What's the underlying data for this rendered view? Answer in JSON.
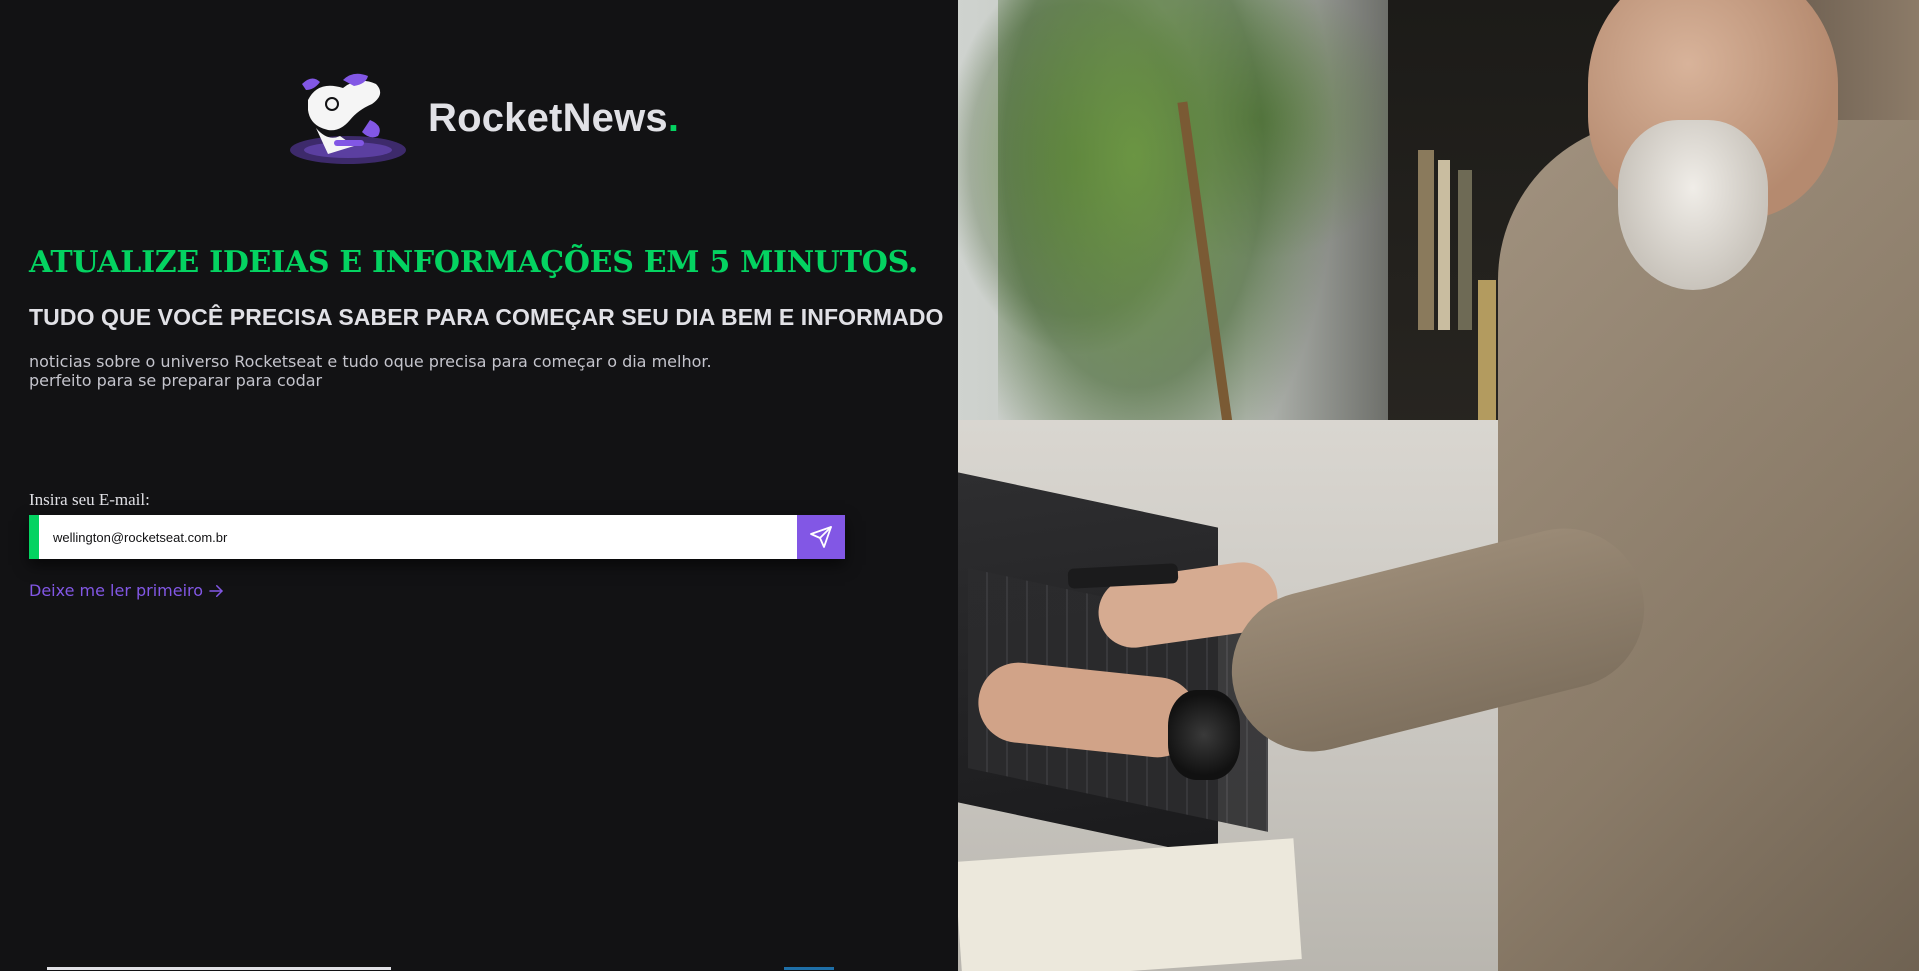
{
  "brand": {
    "name": "RocketNews",
    "dot": "."
  },
  "hero": {
    "headline": "ATUALIZE IDEIAS E INFORMAÇÕES EM 5 MINUTOS.",
    "subhead": "TUDO QUE VOCÊ PRECISA SABER PARA COMEÇAR SEU DIA BEM E INFORMADO",
    "desc_line1": "noticias sobre o universo Rocketseat e tudo oque precisa para começar o dia melhor.",
    "desc_line2": "perfeito para se preparar para codar"
  },
  "form": {
    "label": "Insira seu E-mail:",
    "email_value": "wellington@rocketseat.com.br",
    "send_icon": "send-icon"
  },
  "links": {
    "read_first": "Deixe me ler primeiro"
  },
  "colors": {
    "background": "#121214",
    "accent_green": "#04d361",
    "accent_purple": "#8257e5",
    "text": "#e1e1e6"
  }
}
